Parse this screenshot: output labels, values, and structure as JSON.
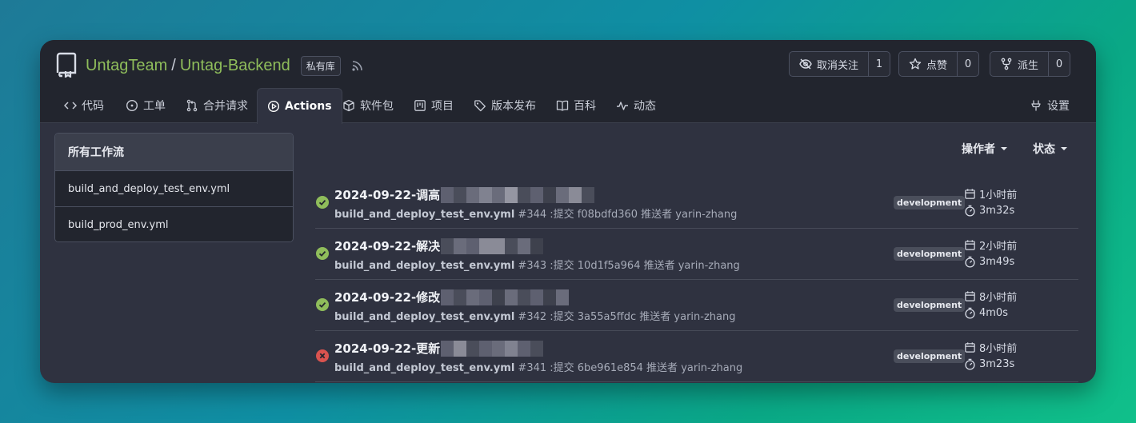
{
  "repo": {
    "owner": "UntagTeam",
    "separator": "/",
    "name": "Untag-Backend",
    "visibility": "私有库"
  },
  "actions_bar": {
    "watch": {
      "label": "取消关注",
      "count": "1"
    },
    "star": {
      "label": "点赞",
      "count": "0"
    },
    "fork": {
      "label": "派生",
      "count": "0"
    }
  },
  "tabs": [
    {
      "label": "代码",
      "icon": "code-icon"
    },
    {
      "label": "工单",
      "icon": "issue-icon"
    },
    {
      "label": "合并请求",
      "icon": "pull-request-icon"
    },
    {
      "label": "Actions",
      "icon": "play-icon",
      "active": true
    },
    {
      "label": "软件包",
      "icon": "package-icon"
    },
    {
      "label": "项目",
      "icon": "project-icon"
    },
    {
      "label": "版本发布",
      "icon": "tag-icon"
    },
    {
      "label": "百科",
      "icon": "book-icon"
    },
    {
      "label": "动态",
      "icon": "pulse-icon"
    },
    {
      "label": "设置",
      "icon": "tools-icon"
    }
  ],
  "sidebar": {
    "header": "所有工作流",
    "items": [
      "build_and_deploy_test_env.yml",
      "build_prod_env.yml"
    ]
  },
  "filters": {
    "actor": "操作者",
    "status": "状态"
  },
  "runs": [
    {
      "title": "2024-09-22-调高",
      "workflow": "build_and_deploy_test_env.yml",
      "detail": " #344 :提交 f08bdfd360 推送者 yarin-zhang",
      "branch": "development",
      "time": "1小时前",
      "duration": "3m32s",
      "status": "success"
    },
    {
      "title": "2024-09-22-解决",
      "workflow": "build_and_deploy_test_env.yml",
      "detail": " #343 :提交 10d1f5a964 推送者 yarin-zhang",
      "branch": "development",
      "time": "2小时前",
      "duration": "3m49s",
      "status": "success"
    },
    {
      "title": "2024-09-22-修改",
      "workflow": "build_and_deploy_test_env.yml",
      "detail": " #342 :提交 3a55a5ffdc 推送者 yarin-zhang",
      "branch": "development",
      "time": "8小时前",
      "duration": "4m0s",
      "status": "success"
    },
    {
      "title": "2024-09-22-更新",
      "workflow": "build_and_deploy_test_env.yml",
      "detail": " #341 :提交 6be961e854 推送者 yarin-zhang",
      "branch": "development",
      "time": "8小时前",
      "duration": "3m23s",
      "status": "failure"
    }
  ],
  "colors": {
    "success": "#8fbd5b",
    "failure": "#d9534f",
    "accent": "#8fbd5b"
  }
}
